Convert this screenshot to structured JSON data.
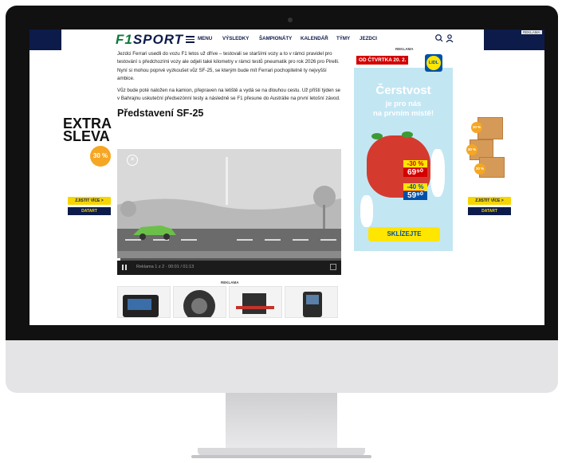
{
  "site": {
    "logo_prefix": "F1",
    "logo_suffix": "SPORT",
    "menu_label": "MENU",
    "nav": [
      "VÝSLEDKY",
      "ŠAMPIONÁTY",
      "KALENDÁŘ",
      "TÝMY",
      "JEZDCI"
    ],
    "search_icon": "search-icon",
    "user_icon": "user-icon",
    "top_ad_label": "REKLAMA"
  },
  "article": {
    "paragraph_1": "Jezdci Ferrari usedli do vozu F1 letos už dříve – testovali se staršími vozy a to v rámci pravidel pro testování s předchozími vozy ale odjeli také kilometry v rámci testů pneumatik pro rok 2026 pro Pirelli. Nyní si mohou poprvé vyzkoušet vůz SF-25, se kterým bude mít Ferrari pochopitelně ty nejvyšší ambice.",
    "paragraph_2": "Vůz bude poté naložen na kamion, přepraven na letiště a vydá se na dlouhou cestu. Už příští týden se v Bahrajnu uskuteční předsezónní testy a následně se F1 přesune do Austrálie na první letošní závod.",
    "heading": "Představení SF-25"
  },
  "video": {
    "time": "Reklama 1 z 2 · 00:01 / 01:13",
    "progress": 0.013
  },
  "product_ad": {
    "label": "REKLAMA",
    "adchoices": "▷ X"
  },
  "lidl_ad": {
    "label": "REKLAMA",
    "date": "OD ČTVRTKA 20. 2.",
    "logo_text": "LIDL",
    "headline": "Čerstvost",
    "subline_1": "je pro nás",
    "subline_2": "na prvním místě!",
    "discount_1": "-30 %",
    "price_1": "69⁹⁰",
    "discount_2": "-40 %",
    "price_2": "59⁹⁰",
    "cta": "SKLÍZEJTE"
  },
  "side_ad_left": {
    "headline_1": "EXTRA",
    "headline_2": "SLEVA",
    "badge": "30 %",
    "cta": "ZJISTIT VÍCE >",
    "brand": "DATART"
  },
  "side_ad_right": {
    "badges": [
      "30 %",
      "30 %",
      "30 %"
    ],
    "cta": "ZJISTIT VÍCE >",
    "brand": "DATART"
  }
}
